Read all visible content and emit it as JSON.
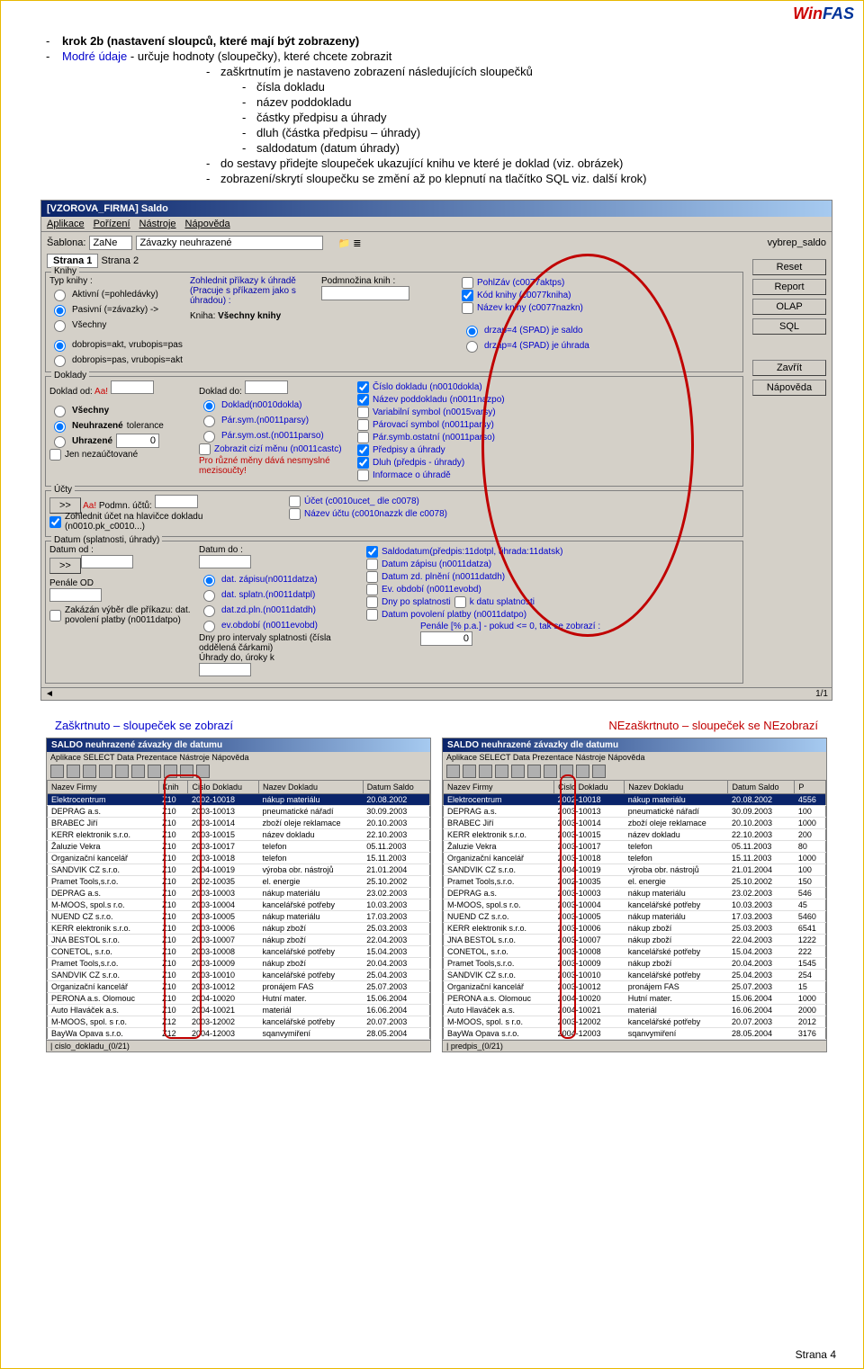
{
  "logo": {
    "w": "Win",
    "rest": "FAS"
  },
  "l1": "krok 2b (nastavení sloupců, které mají být zobrazeny)",
  "l2a": "Modré údaje",
  "l2b": "- určuje hodnoty (sloupečky), které chcete zobrazit",
  "l3": "zaškrtnutím je nastaveno zobrazení následujících sloupečků",
  "s1": "čísla dokladu",
  "s2": "název poddokladu",
  "s3": "částky předpisu a úhrady",
  "s4": "dluh (částka předpisu – úhrady)",
  "s5": "saldodatum (datum úhrady)",
  "l4": "do sestavy přidejte sloupeček ukazující knihu ve které je doklad (viz. obrázek)",
  "l5": "zobrazení/skrytí sloupečku se změní až po klepnutí na tlačítko SQL viz. další krok)",
  "win1": {
    "title": "[VZOROVA_FIRMA] Saldo",
    "menu": [
      "Aplikace",
      "Pořízení",
      "Nástroje",
      "Nápověda"
    ],
    "sablona": "Šablona:",
    "zane": "ZaNe",
    "zav": "Závazky neuhrazené",
    "rt": "vybrep_saldo",
    "tab1": "Strana 1",
    "tab2": "Strana 2",
    "knihy": "Knihy",
    "typ": "Typ knihy :",
    "r1": "Aktivní (=pohledávky)",
    "r2": "Pasivní (=závazky) ->",
    "r3": "Všechny",
    "zohled": "Zohlednit příkazy k úhradě (Pracuje s příkazem jako s úhradou) :",
    "podm": "Podmnožina knih :",
    "cdp1": "dobropis=akt, vrubopis=pas",
    "cdp2": "dobropis=pas, vrubopis=akt",
    "kniha": "Kniha:",
    "vsechny": "Všechny knihy",
    "c1": "PohlZáv (c0077aktps)",
    "c2": "Kód knihy (c0077kniha)",
    "c3": "Název knihy (c0077nazkn)",
    "c4": "drzap=4 (SPAD) je saldo",
    "c5": "drzap=4 (SPAD) je úhrada",
    "doklady": "Doklady",
    "dod": "Doklad od:",
    "aa": "Aa!",
    "ddo": "Doklad do:",
    "dk1": "Doklad(n0010dokla)",
    "dk2": "Pár.sym.(n0011parsy)",
    "dk3": "Pár.sym.ost.(n0011parso)",
    "cd1": "Číslo dokladu (n0010dokla)",
    "cd2": "Název poddokladu (n0011nazpo)",
    "cd3": "Variabilní symbol (n0015varsy)",
    "cd4": "Párovací symbol (n0011parsy)",
    "cd5": "Pár.symb.ostatní (n0011parso)",
    "cd6": "Předpisy a úhrady",
    "cd7": "Dluh (předpis - úhrady)",
    "cd8": "Informace o úhradě",
    "vse": "Všechny",
    "neuh": "Neuhrazené",
    "uhr": "Uhrazené",
    "tol": "tolerance",
    "zero": "0",
    "zobr": "Zobrazit cizí měnu (n0011castc)",
    "pro": "Pro různé měny dává nesmyslné mezisoučty!",
    "jen": "Jen nezaúčtované",
    "ucty": "Účty",
    "zu": "Zohlednit účet na hlavičce dokladu (n0010.pk_c0010...)",
    "podmn": "Podmn. účtů:",
    "u1": "Účet (c0010ucet_ dle c0078)",
    "u2": "Název účtu (c0010nazzk dle c0078)",
    "datum": "Datum (splatnosti, úhrady)",
    "dtod": "Datum od :",
    "dtdo": "Datum do :",
    "d1": "dat. zápisu(n0011datza)",
    "d2": "dat. splatn.(n0011datpl)",
    "d3": "dat.zd.pln.(n0011datdh)",
    "d4": "ev.období (n0011evobd)",
    "dzp": "Dny pro intervaly splatnosti (čísla oddělená čárkami)",
    "e1": "Saldodatum(předpis:11dotpl, úhrada:11datsk)",
    "e2": "Datum zápisu (n0011datza)",
    "e3": "Datum zd. plnění (n0011datdh)",
    "e4": "Ev. období (n0011evobd)",
    "e5": "Dny po splatnosti",
    "e6": "k datu splatnosti",
    "e7": "Datum povolení platby (n0011datpo)",
    "pen": "Penále OD",
    "uhk": "Úhrady do, úroky k",
    "pena": "Penále [% p.a.] - pokud <= 0, tak se zobrazí :",
    "zak": "Zakázán výběr dle příkazu: dat. povolení platby (n0011datpo)",
    "btns": {
      "reset": "Reset",
      "report": "Report",
      "olap": "OLAP",
      "sql": "SQL",
      "zavrit": "Zavřít",
      "nap": "Nápověda"
    },
    "page": "1/1"
  },
  "cap1": "Zaškrtnuto – sloupeček se zobrazí",
  "cap2": "NEzaškrtnuto – sloupeček se NEzobrazí",
  "t1": {
    "title": "SALDO neuhrazené závazky dle datumu",
    "menu": "Aplikace SELECT Data Prezentace Nástroje Nápověda",
    "cols": [
      "Nazev Firmy",
      "Knih",
      "Cislo Dokladu",
      "Nazev Dokladu",
      "Datum Saldo"
    ],
    "st": "| cislo_dokladu_(0/21)"
  },
  "t2": {
    "title": "SALDO neuhrazené závazky dle datumu",
    "menu": "Aplikace SELECT Data Prezentace Nástroje Nápověda",
    "cols": [
      "Nazev Firmy",
      "Cislo Dokladu",
      "Nazev Dokladu",
      "Datum Saldo",
      "P"
    ],
    "st": "| predpis_(0/21)"
  },
  "rows": [
    [
      "Elektrocentrum",
      "Z10",
      "2002-10018",
      "nákup materiálu",
      "20.08.2002",
      "4556"
    ],
    [
      "DEPRAG a.s.",
      "Z10",
      "2003-10013",
      "pneumatické nářadí",
      "30.09.2003",
      "100"
    ],
    [
      "BRABEC Jiří",
      "Z10",
      "2003-10014",
      "zboží oleje reklamace",
      "20.10.2003",
      "1000"
    ],
    [
      "KERR elektronik s.r.o.",
      "Z10",
      "2003-10015",
      "název dokladu",
      "22.10.2003",
      "200"
    ],
    [
      "Žaluzie Vekra",
      "Z10",
      "2003-10017",
      "telefon",
      "05.11.2003",
      "80"
    ],
    [
      "Organizační kancelář",
      "Z10",
      "2003-10018",
      "telefon",
      "15.11.2003",
      "1000"
    ],
    [
      "SANDVIK CZ s.r.o.",
      "Z10",
      "2004-10019",
      "výroba obr. nástrojů",
      "21.01.2004",
      "100"
    ],
    [
      "Pramet Tools,s.r.o.",
      "Z10",
      "2002-10035",
      "el. energie",
      "25.10.2002",
      "150"
    ],
    [
      "DEPRAG a.s.",
      "Z10",
      "2003-10003",
      "nákup materiálu",
      "23.02.2003",
      "546"
    ],
    [
      "M-MOOS, spol.s r.o.",
      "Z10",
      "2003-10004",
      "kancelářské potřeby",
      "10.03.2003",
      "45"
    ],
    [
      "NUEND CZ s.r.o.",
      "Z10",
      "2003-10005",
      "nákup materiálu",
      "17.03.2003",
      "5460"
    ],
    [
      "KERR elektronik s.r.o.",
      "Z10",
      "2003-10006",
      "nákup zboží",
      "25.03.2003",
      "6541"
    ],
    [
      "JNA BESTOL s.r.o.",
      "Z10",
      "2003-10007",
      "nákup zboží",
      "22.04.2003",
      "1222"
    ],
    [
      "CONETOL, s.r.o.",
      "Z10",
      "2003-10008",
      "kancelářské potřeby",
      "15.04.2003",
      "222"
    ],
    [
      "Pramet Tools,s.r.o.",
      "Z10",
      "2003-10009",
      "nákup zboží",
      "20.04.2003",
      "1545"
    ],
    [
      "SANDVIK CZ s.r.o.",
      "Z10",
      "2003-10010",
      "kancelářské potřeby",
      "25.04.2003",
      "254"
    ],
    [
      "Organizační kancelář",
      "Z10",
      "2003-10012",
      "pronájem FAS",
      "25.07.2003",
      "15"
    ],
    [
      "PERONA a.s. Olomouc",
      "Z10",
      "2004-10020",
      "Hutní mater.",
      "15.06.2004",
      "1000"
    ],
    [
      "Auto Hlaváček a.s.",
      "Z10",
      "2004-10021",
      "materiál",
      "16.06.2004",
      "2000"
    ],
    [
      "M-MOOS, spol. s r.o.",
      "Z12",
      "2003-12002",
      "kancelářské potřeby",
      "20.07.2003",
      "2012"
    ],
    [
      "BayWa Opava s.r.o.",
      "Z12",
      "2004-12003",
      "sqanvymiření",
      "28.05.2004",
      "3176"
    ]
  ],
  "footer": "Strana 4"
}
